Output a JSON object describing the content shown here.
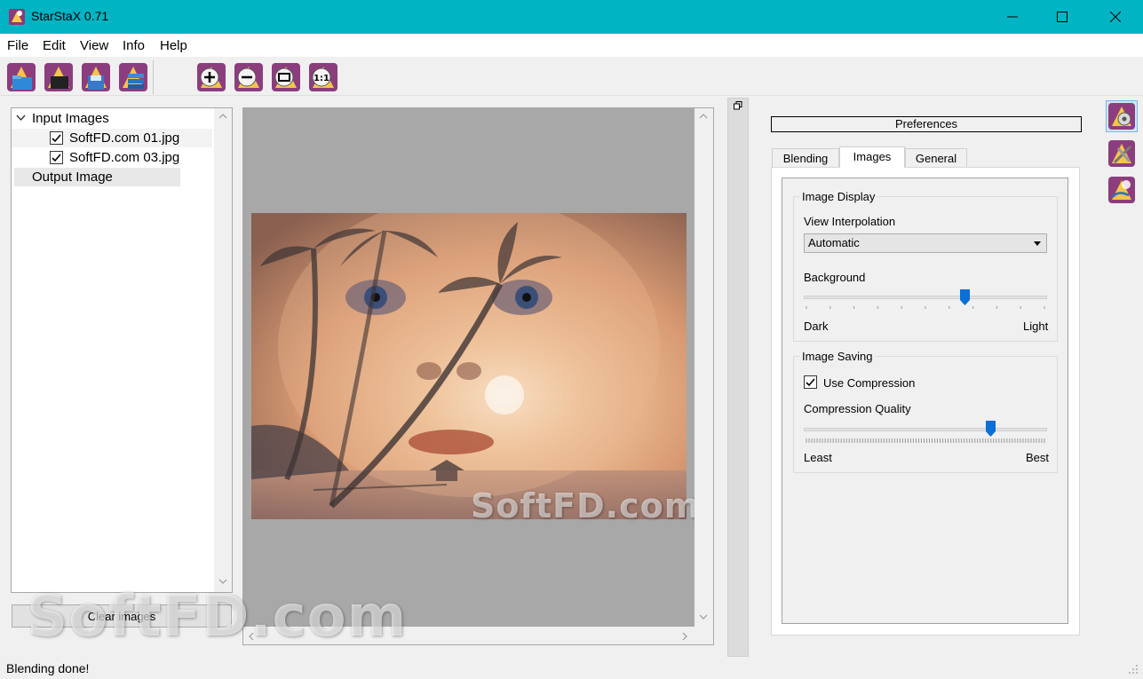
{
  "window": {
    "title": "StarStaX 0.71"
  },
  "menu": [
    "File",
    "Edit",
    "View",
    "Info",
    "Help"
  ],
  "tree": {
    "input_label": "Input Images",
    "files": [
      "SoftFD.com 01.jpg",
      "SoftFD.com 03.jpg"
    ],
    "output_label": "Output Image"
  },
  "clear_button": "Clear images",
  "preferences": {
    "header": "Preferences",
    "tabs": [
      "Blending",
      "Images",
      "General"
    ],
    "active_tab": "Images",
    "image_display": {
      "title": "Image Display",
      "interp_label": "View Interpolation",
      "interp_value": "Automatic",
      "background_label": "Background",
      "background_level": 0.67,
      "min_label": "Dark",
      "max_label": "Light"
    },
    "image_saving": {
      "title": "Image Saving",
      "compression_label": "Use Compression",
      "compression_checked": true,
      "quality_label": "Compression Quality",
      "quality_level": 0.78,
      "min_label": "Least",
      "max_label": "Best"
    }
  },
  "status": "Blending done!",
  "watermark": "SoftFD.com",
  "colors": {
    "titlebar": "#00b4c4",
    "slider_thumb": "#0a6fd6"
  }
}
